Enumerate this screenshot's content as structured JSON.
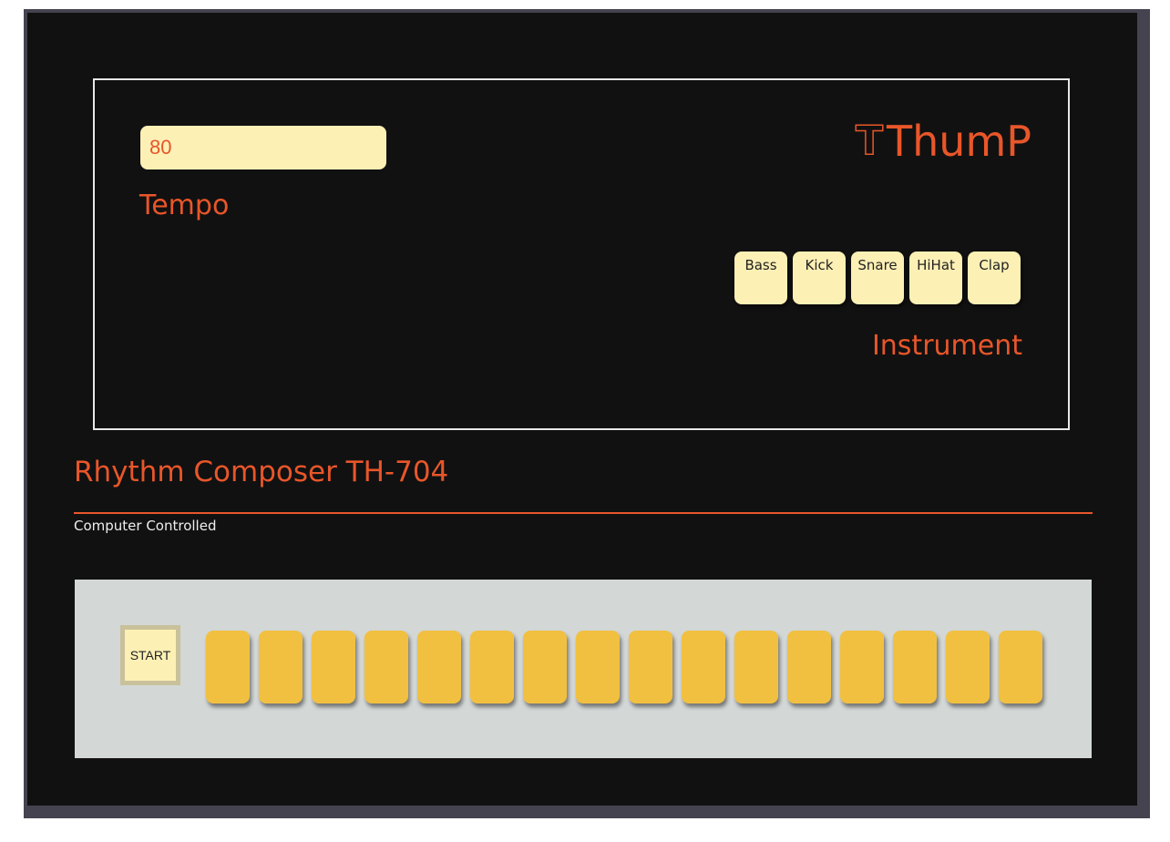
{
  "display": {
    "tempo_value": "80",
    "tempo_label": "Tempo",
    "logo_icon": "T",
    "logo_text": "ThumP",
    "instruments": [
      "Bass",
      "Kick",
      "Snare",
      "HiHat",
      "Clap"
    ],
    "instrument_label": "Instrument"
  },
  "header": {
    "title": "Rhythm Composer TH-704",
    "subtitle": "Computer Controlled"
  },
  "sequencer": {
    "start_label": "START",
    "step_count": 16
  },
  "colors": {
    "accent": "#e8562a",
    "panel": "#111111",
    "button_face": "#fdf0b5",
    "step": "#f2c040",
    "sequencer_bg": "#d3d7d6"
  }
}
